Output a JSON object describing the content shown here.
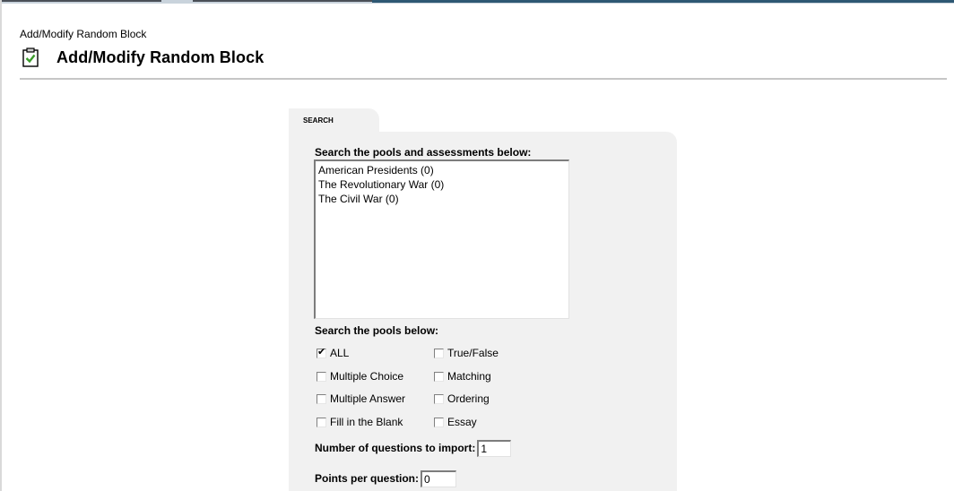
{
  "breadcrumb": "Add/Modify Random Block",
  "page_title": "Add/Modify Random Block",
  "tab": {
    "label": "SEARCH"
  },
  "search": {
    "pools_assessments_label": "Search the pools and assessments below:",
    "items": [
      "American Presidents (0)",
      "The Revolutionary War (0)",
      "The Civil War (0)"
    ],
    "pools_label": "Search the pools below:",
    "question_types": [
      {
        "label": "ALL",
        "checked": true
      },
      {
        "label": "True/False",
        "checked": false
      },
      {
        "label": "Multiple Choice",
        "checked": false
      },
      {
        "label": "Matching",
        "checked": false
      },
      {
        "label": "Multiple Answer",
        "checked": false
      },
      {
        "label": "Ordering",
        "checked": false
      },
      {
        "label": "Fill in the Blank",
        "checked": false
      },
      {
        "label": "Essay",
        "checked": false
      }
    ]
  },
  "import": {
    "num_questions_label": "Number of questions to import:",
    "num_questions_value": "1",
    "points_label": "Points per question:",
    "points_value": "0"
  },
  "icons": {
    "title_icon": "clipboard-check-icon"
  }
}
